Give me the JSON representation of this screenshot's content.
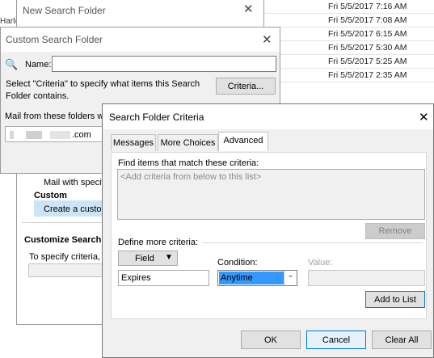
{
  "mail_list": {
    "dates": [
      "Fri 5/5/2017 7:16 AM",
      "Fri 5/5/2017 7:08 AM",
      "Fri 5/5/2017 6:15 AM",
      "Fri 5/5/2017 5:30 AM",
      "Fri 5/5/2017 5:25 AM",
      "Fri 5/5/2017 2:35 AM"
    ],
    "left_fragment": "Harte"
  },
  "new_search_folder": {
    "title": "New Search Folder",
    "mail_with_specific": "Mail with specif",
    "custom_heading": "Custom",
    "create_custom": "Create a custon",
    "customize_heading": "Customize Search Fo",
    "to_specify": "To specify criteria, c"
  },
  "custom_search_folder": {
    "title": "Custom Search Folder",
    "name_label": "Name:",
    "name_value": "",
    "criteria_desc": "Select \"Criteria\" to specify what items this Search Folder contains.",
    "criteria_button": "Criteria...",
    "mail_from": "Mail from these folders wi",
    "folder_value": ".com"
  },
  "criteria_dialog": {
    "title": "Search Folder Criteria",
    "tabs": [
      "Messages",
      "More Choices",
      "Advanced"
    ],
    "find_label": "Find items that match these criteria:",
    "list_placeholder": "<Add criteria from below to this list>",
    "remove_button": "Remove",
    "define_label": "Define more criteria:",
    "field_button": "Field",
    "condition_label": "Condition:",
    "value_label": "Value:",
    "field_value": "Expires",
    "condition_value": "Anytime",
    "value_value": "",
    "add_button": "Add to List",
    "ok_button": "OK",
    "cancel_button": "Cancel",
    "clear_button": "Clear All"
  },
  "colors": {
    "selection": "#3399ff",
    "highlight_blue": "#cce4f7",
    "focus_border": "#0078d7"
  }
}
